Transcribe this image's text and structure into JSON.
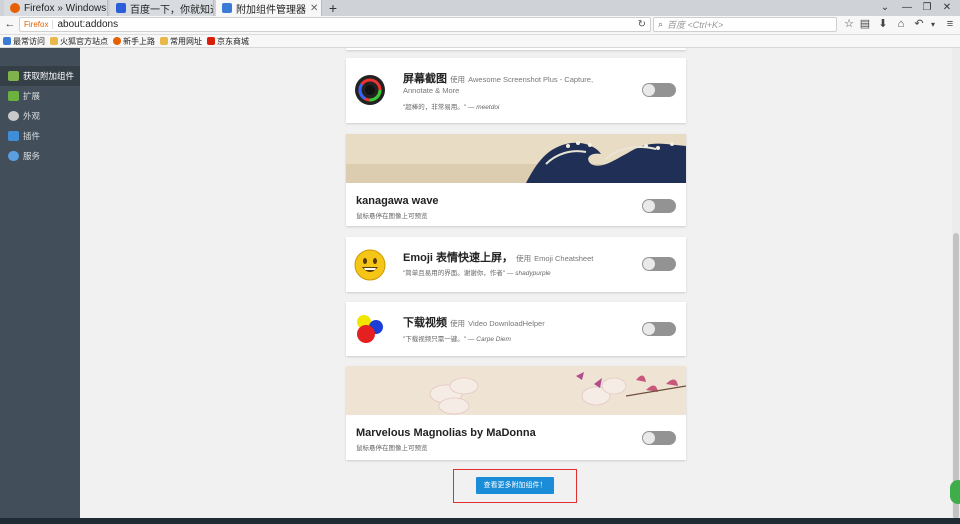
{
  "tabs": [
    {
      "label": "Firefox » Windows 10 ...",
      "active": false
    },
    {
      "label": "百度一下，你就知道",
      "active": false
    },
    {
      "label": "附加组件管理器",
      "active": true
    }
  ],
  "urlbar": {
    "badge": "Firefox",
    "url": "about:addons"
  },
  "search": {
    "placeholder": "百度 <Ctrl+K>"
  },
  "bookmarks": [
    "最常访问",
    "火狐官方站点",
    "新手上路",
    "常用网址",
    "京东商城"
  ],
  "sidebar": {
    "items": [
      {
        "label": "获取附加组件",
        "active": true,
        "icon": "get-addons-icon"
      },
      {
        "label": "扩展",
        "active": false,
        "icon": "puzzle-icon"
      },
      {
        "label": "外观",
        "active": false,
        "icon": "palette-icon"
      },
      {
        "label": "插件",
        "active": false,
        "icon": "plugin-icon"
      },
      {
        "label": "服务",
        "active": false,
        "icon": "cloud-icon"
      }
    ]
  },
  "addons": [
    {
      "title": "屏幕截图",
      "by_prefix": "使用",
      "by_name": "Awesome Screenshot Plus - Capture, Annotate & More",
      "quote": "\"超棒的，非常易用。\"",
      "author": "meetdoi"
    },
    {
      "title": "kanagawa wave",
      "hint": "鼠标悬停在图像上可预览"
    },
    {
      "title": "Emoji 表情快速上屏，",
      "by_prefix": "使用",
      "by_name": "Emoji Cheatsheet",
      "quote": "\"简单且易用的界面。谢谢你，作者\"",
      "author": "shadypurple"
    },
    {
      "title": "下载视频",
      "by_prefix": "使用",
      "by_name": "Video DownloadHelper",
      "quote": "\"下载视频只需一键。\"",
      "author": "Carpe Diem"
    },
    {
      "title": "Marvelous Magnolias by MaDonna",
      "hint": "鼠标悬停在图像上可预览"
    }
  ],
  "more_button": "查看更多附加组件！",
  "colors": {
    "sidebar": "#424f5a",
    "accent": "#1a8cd8",
    "toggle": "#939393"
  }
}
